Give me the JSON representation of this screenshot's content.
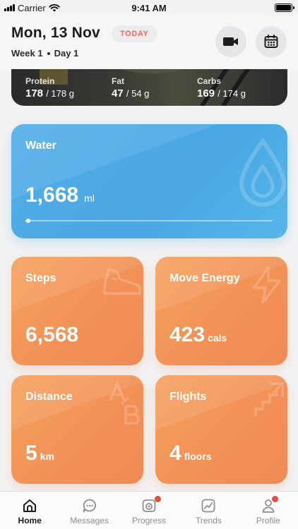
{
  "status_bar": {
    "carrier": "Carrier",
    "time": "9:41 AM"
  },
  "header": {
    "date": "Mon, 13 Nov",
    "today_badge": "TODAY",
    "week": "Week 1",
    "day": "Day 1",
    "video_icon": "video-camera-icon",
    "calendar_icon": "calendar-icon"
  },
  "nutrition": {
    "protein": {
      "label": "Protein",
      "value": "178",
      "goal": "/ 178 g"
    },
    "fat": {
      "label": "Fat",
      "value": "47",
      "goal": "/ 54 g"
    },
    "carbs": {
      "label": "Carbs",
      "value": "169",
      "goal": "/ 174 g"
    }
  },
  "water": {
    "title": "Water",
    "value": "1,668",
    "unit": "ml",
    "progress_fraction": 0.01,
    "icon": "water-drop-icon"
  },
  "steps": {
    "title": "Steps",
    "value": "6,568",
    "icon": "shoe-icon"
  },
  "move_energy": {
    "title": "Move Energy",
    "value": "423",
    "unit": "cals",
    "icon": "lightning-icon"
  },
  "distance": {
    "title": "Distance",
    "value": "5",
    "unit": "km",
    "icon": "a-to-b-icon"
  },
  "flights": {
    "title": "Flights",
    "value": "4",
    "unit": "floors",
    "icon": "stairs-icon"
  },
  "tabbar": {
    "items": [
      {
        "label": "Home",
        "icon": "home-icon",
        "active": true,
        "badge": false
      },
      {
        "label": "Messages",
        "icon": "chat-icon",
        "active": false,
        "badge": false
      },
      {
        "label": "Progress",
        "icon": "camera-icon",
        "active": false,
        "badge": true
      },
      {
        "label": "Trends",
        "icon": "trends-icon",
        "active": false,
        "badge": false
      },
      {
        "label": "Profile",
        "icon": "person-icon",
        "active": false,
        "badge": true
      }
    ]
  },
  "colors": {
    "water": "#4aa7e3",
    "orange": "#f29257",
    "badge": "#f0473f",
    "today_text": "#f06a5a"
  }
}
